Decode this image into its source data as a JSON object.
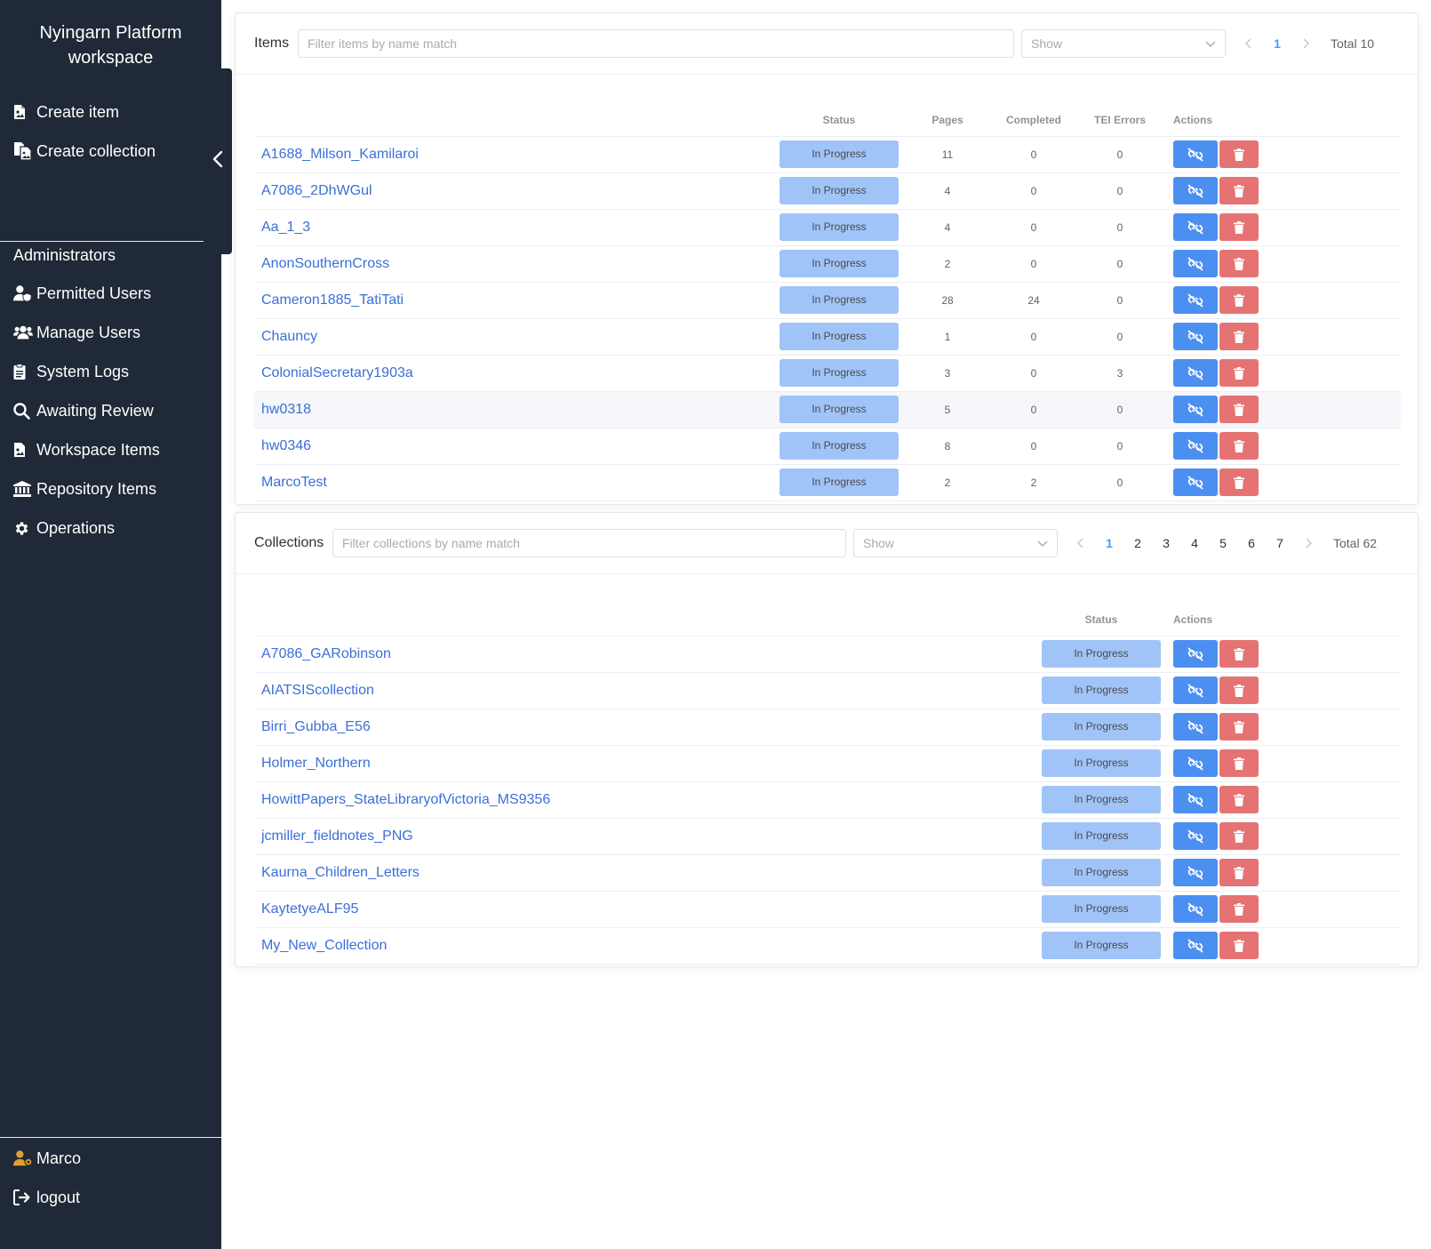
{
  "sidebar": {
    "brand": "Nyingarn Platform workspace",
    "top_items": [
      {
        "label": "Create item",
        "icon": "file-image-icon"
      },
      {
        "label": "Create collection",
        "icon": "files-icon"
      }
    ],
    "admin_section_title": "Administrators",
    "admin_items": [
      {
        "label": "Permitted Users",
        "icon": "user-shield-icon"
      },
      {
        "label": "Manage Users",
        "icon": "users-icon"
      },
      {
        "label": "System Logs",
        "icon": "clipboard-icon"
      },
      {
        "label": "Awaiting Review",
        "icon": "search-icon"
      },
      {
        "label": "Workspace Items",
        "icon": "file-image-icon"
      },
      {
        "label": "Repository Items",
        "icon": "landmark-icon"
      },
      {
        "label": "Operations",
        "icon": "gear-icon"
      }
    ],
    "user_name": "Marco",
    "logout_label": "logout"
  },
  "items_panel": {
    "title": "Items",
    "filter_placeholder": "Filter items by name match",
    "show_placeholder": "Show",
    "pages": [
      "1"
    ],
    "active_page": "1",
    "total": "Total 10",
    "columns": {
      "status": "Status",
      "pages": "Pages",
      "completed": "Completed",
      "tei_errors": "TEI Errors",
      "actions": "Actions"
    },
    "rows": [
      {
        "name": "A1688_Milson_Kamilaroi",
        "status": "In Progress",
        "pages": "11",
        "completed": "0",
        "tei_errors": "0"
      },
      {
        "name": "A7086_2DhWGul",
        "status": "In Progress",
        "pages": "4",
        "completed": "0",
        "tei_errors": "0"
      },
      {
        "name": "Aa_1_3",
        "status": "In Progress",
        "pages": "4",
        "completed": "0",
        "tei_errors": "0"
      },
      {
        "name": "AnonSouthernCross",
        "status": "In Progress",
        "pages": "2",
        "completed": "0",
        "tei_errors": "0"
      },
      {
        "name": "Cameron1885_TatiTati",
        "status": "In Progress",
        "pages": "28",
        "completed": "24",
        "tei_errors": "0"
      },
      {
        "name": "Chauncy",
        "status": "In Progress",
        "pages": "1",
        "completed": "0",
        "tei_errors": "0"
      },
      {
        "name": "ColonialSecretary1903a",
        "status": "In Progress",
        "pages": "3",
        "completed": "0",
        "tei_errors": "3"
      },
      {
        "name": "hw0318",
        "status": "In Progress",
        "pages": "5",
        "completed": "0",
        "tei_errors": "0"
      },
      {
        "name": "hw0346",
        "status": "In Progress",
        "pages": "8",
        "completed": "0",
        "tei_errors": "0"
      },
      {
        "name": "MarcoTest",
        "status": "In Progress",
        "pages": "2",
        "completed": "2",
        "tei_errors": "0"
      }
    ]
  },
  "collections_panel": {
    "title": "Collections",
    "filter_placeholder": "Filter collections by name match",
    "show_placeholder": "Show",
    "pages": [
      "1",
      "2",
      "3",
      "4",
      "5",
      "6",
      "7"
    ],
    "active_page": "1",
    "total": "Total 62",
    "columns": {
      "status": "Status",
      "actions": "Actions"
    },
    "rows": [
      {
        "name": "A7086_GARobinson",
        "status": "In Progress"
      },
      {
        "name": "AIATSIScollection",
        "status": "In Progress"
      },
      {
        "name": "Birri_Gubba_E56",
        "status": "In Progress"
      },
      {
        "name": "Holmer_Northern",
        "status": "In Progress"
      },
      {
        "name": "HowittPapers_StateLibraryofVictoria_MS9356",
        "status": "In Progress"
      },
      {
        "name": "jcmiller_fieldnotes_PNG",
        "status": "In Progress"
      },
      {
        "name": "Kaurna_Children_Letters",
        "status": "In Progress"
      },
      {
        "name": "KaytetyeALF95",
        "status": "In Progress"
      },
      {
        "name": "My_New_Collection",
        "status": "In Progress"
      }
    ]
  },
  "colors": {
    "sidebar_bg": "#1f2937",
    "link": "#3b6fd8",
    "status_bg": "#a0c4f8",
    "action_blue": "#4b8ff0",
    "action_red": "#e57373",
    "active_page": "#409eff",
    "user_icon": "#e0a030"
  }
}
